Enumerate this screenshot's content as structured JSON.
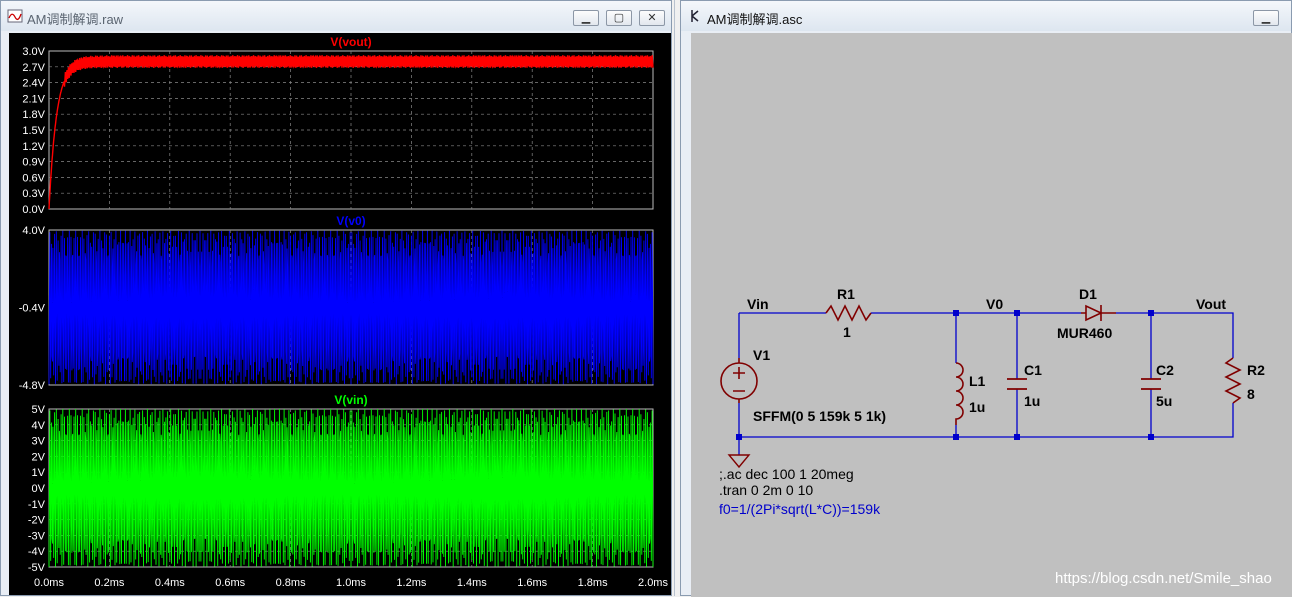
{
  "left_window": {
    "title": "AM调制解调.raw",
    "panes": [
      {
        "trace": "V(vout)",
        "color": "#ff0000",
        "y_ticks": [
          "3.0V",
          "2.7V",
          "2.4V",
          "2.1V",
          "1.8V",
          "1.5V",
          "1.2V",
          "0.9V",
          "0.6V",
          "0.3V",
          "0.0V"
        ]
      },
      {
        "trace": "V(v0)",
        "color": "#0000ff",
        "y_ticks": [
          "4.0V",
          "-0.4V",
          "-4.8V"
        ]
      },
      {
        "trace": "V(vin)",
        "color": "#00ff00",
        "y_ticks": [
          "5V",
          "4V",
          "3V",
          "2V",
          "1V",
          "0V",
          "-1V",
          "-2V",
          "-3V",
          "-4V",
          "-5V"
        ]
      }
    ],
    "x_ticks": [
      "0.0ms",
      "0.2ms",
      "0.4ms",
      "0.6ms",
      "0.8ms",
      "1.0ms",
      "1.2ms",
      "1.4ms",
      "1.6ms",
      "1.8ms",
      "2.0ms"
    ]
  },
  "right_window": {
    "title": "AM调制解调.asc"
  },
  "schematic": {
    "nets": {
      "vin": "Vin",
      "v0": "V0",
      "vout": "Vout"
    },
    "r1": {
      "name": "R1",
      "value": "1"
    },
    "d1": {
      "name": "D1",
      "value": "MUR460"
    },
    "v1": {
      "name": "V1",
      "value": "SFFM(0 5 159k 5 1k)"
    },
    "l1": {
      "name": "L1",
      "value": "1u"
    },
    "c1": {
      "name": "C1",
      "value": "1u"
    },
    "c2": {
      "name": "C2",
      "value": "5u"
    },
    "r2": {
      "name": "R2",
      "value": "8"
    },
    "directives": [
      ";.ac dec 100 1 20meg",
      ".tran 0 2m 0 10"
    ],
    "comment": "f0=1/(2Pi*sqrt(L*C))=159k"
  },
  "watermark": "https://blog.csdn.net/Smile_shao",
  "chart_data": [
    {
      "type": "line",
      "series": [
        {
          "name": "V(vout)",
          "description_values": {
            "steady_min": 2.65,
            "steady_max": 2.95
          }
        }
      ],
      "xlim": [
        0,
        2.0
      ],
      "ylim": [
        0,
        3.0
      ],
      "x_unit": "ms",
      "y_unit": "V",
      "grid": true
    },
    {
      "type": "line",
      "series": [
        {
          "name": "V(v0)",
          "values_range": [
            -4.8,
            4.0
          ]
        }
      ],
      "xlim": [
        0,
        2.0
      ],
      "ylim": [
        -4.8,
        4.0
      ],
      "grid": true
    },
    {
      "type": "line",
      "series": [
        {
          "name": "V(vin)",
          "values_range": [
            -5,
            5
          ],
          "carrier_hz": 159000,
          "amplitude": 5,
          "modulation_index": 5,
          "modulation_hz": 1000
        }
      ],
      "xlim": [
        0,
        2.0
      ],
      "ylim": [
        -5,
        5
      ],
      "grid": true
    }
  ]
}
